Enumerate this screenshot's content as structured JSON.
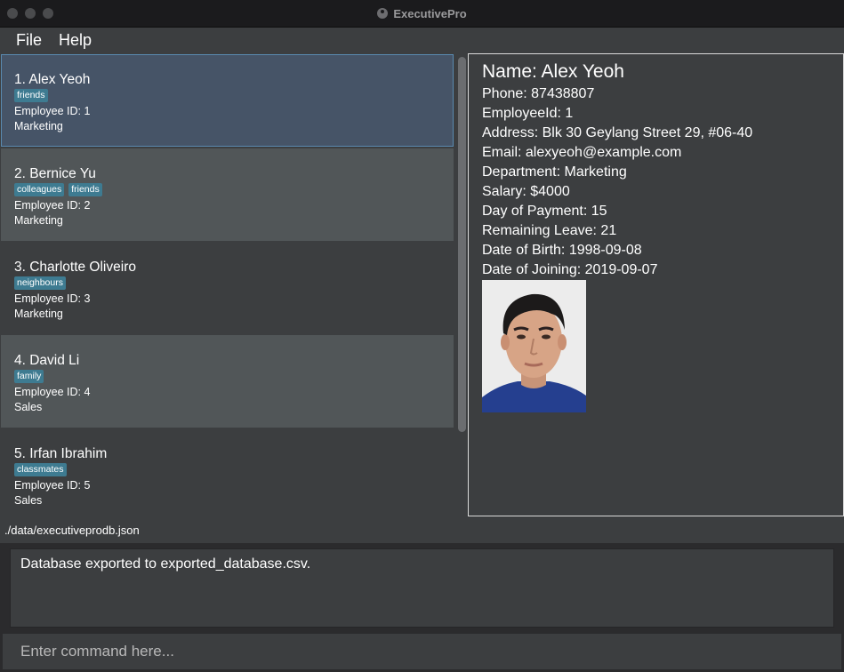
{
  "window": {
    "title": "ExecutivePro"
  },
  "menu": {
    "file": "File",
    "help": "Help"
  },
  "employees": [
    {
      "name": "1.  Alex Yeoh",
      "tags": [
        "friends"
      ],
      "employee_id": "Employee ID: 1",
      "department": "Marketing"
    },
    {
      "name": "2.  Bernice Yu",
      "tags": [
        "colleagues",
        "friends"
      ],
      "employee_id": "Employee ID: 2",
      "department": "Marketing"
    },
    {
      "name": "3.  Charlotte Oliveiro",
      "tags": [
        "neighbours"
      ],
      "employee_id": "Employee ID: 3",
      "department": "Marketing"
    },
    {
      "name": "4.  David Li",
      "tags": [
        "family"
      ],
      "employee_id": "Employee ID: 4",
      "department": "Sales"
    },
    {
      "name": "5.  Irfan Ibrahim",
      "tags": [
        "classmates"
      ],
      "employee_id": "Employee ID: 5",
      "department": "Sales"
    }
  ],
  "detail": {
    "name": "Name: Alex Yeoh",
    "phone": "Phone: 87438807",
    "employee_id": "EmployeeId: 1",
    "address": "Address: Blk 30 Geylang Street 29, #06-40",
    "email": "Email: alexyeoh@example.com",
    "department": "Department: Marketing",
    "salary": "Salary: $4000",
    "day_of_payment": "Day of Payment: 15",
    "remaining_leave": "Remaining Leave: 21",
    "date_of_birth": "Date of Birth: 1998-09-08",
    "date_of_joining": "Date of Joining: 2019-09-07"
  },
  "status": {
    "file_path": "./data/executiveprodb.json"
  },
  "result": {
    "message": "Database exported to exported_database.csv."
  },
  "command": {
    "placeholder": "Enter command here...",
    "value": ""
  },
  "colors": {
    "selected_card": "#465467",
    "card_dark": "#3c3e40",
    "card_light": "#515658",
    "tag": "#3e7b91"
  }
}
